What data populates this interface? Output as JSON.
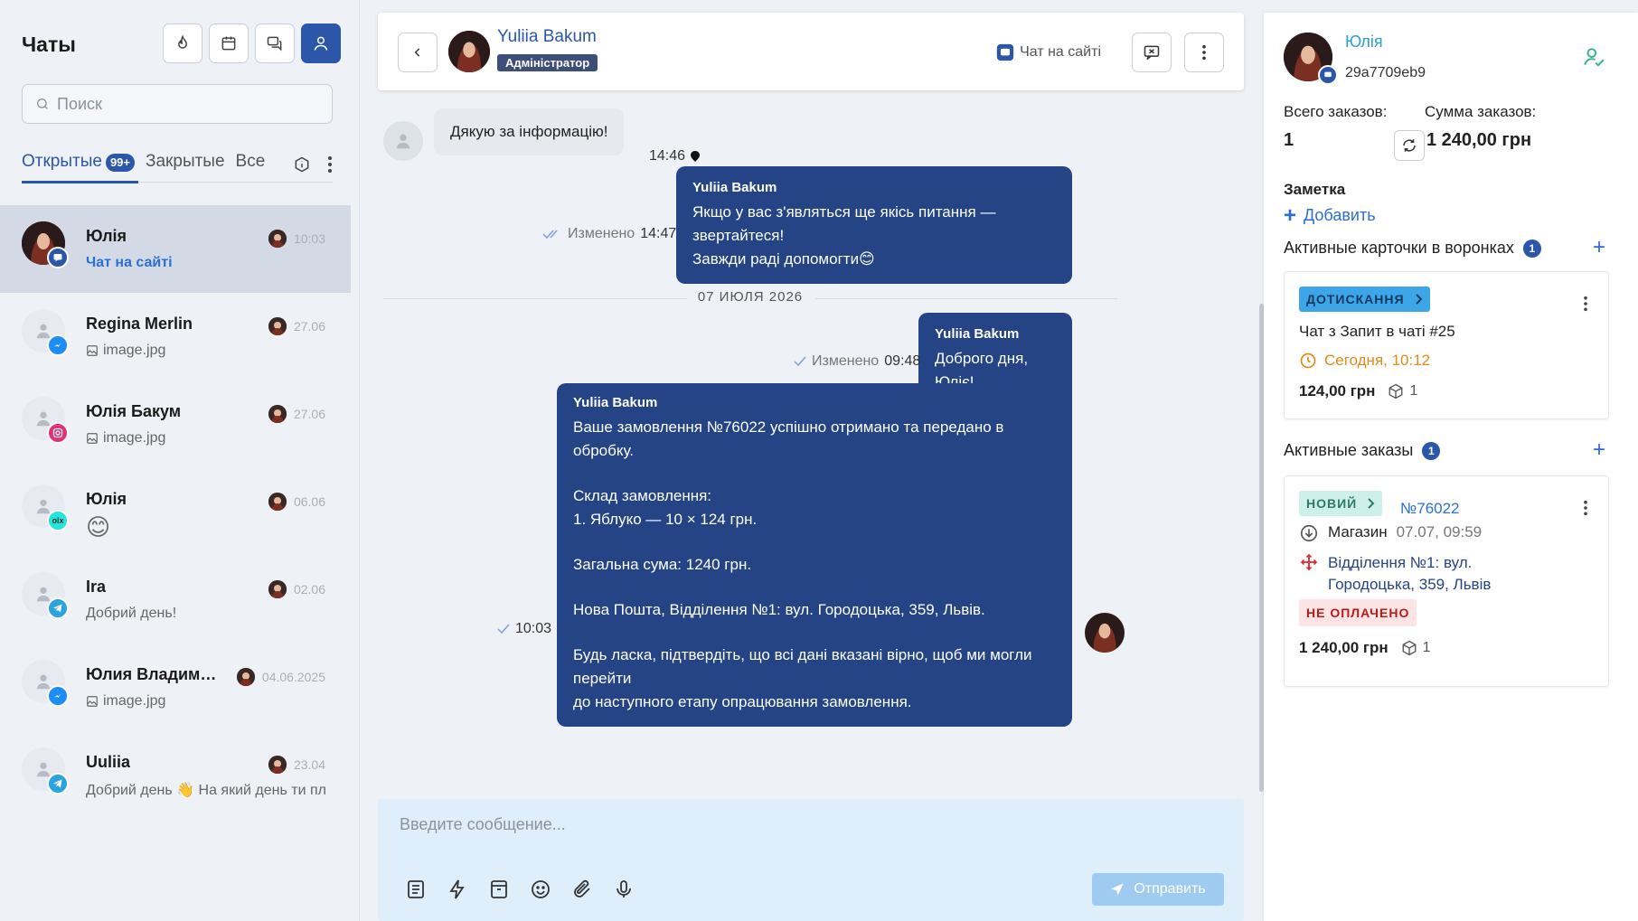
{
  "sidebar": {
    "title": "Чаты",
    "search_placeholder": "Поиск",
    "tabs": [
      {
        "label": "Открытые",
        "badge": "99+"
      },
      {
        "label": "Закрытые"
      },
      {
        "label": "Все"
      }
    ],
    "chats": [
      {
        "name": "Юлія",
        "preview": "Чат на сайті",
        "time": "10:03",
        "channel": "site"
      },
      {
        "name": "Regina Merlin",
        "preview": "image.jpg",
        "time": "27.06",
        "channel": "messenger"
      },
      {
        "name": "Юлія Бакум",
        "preview": "image.jpg",
        "time": "27.06",
        "channel": "instagram"
      },
      {
        "name": "Юлія",
        "preview": "😊",
        "time": "06.06",
        "channel": "olx"
      },
      {
        "name": "Ira",
        "preview": "Добрий день!",
        "time": "02.06",
        "channel": "telegram"
      },
      {
        "name": "Юлия Владимировна",
        "preview": "image.jpg",
        "time": "04.06.2025",
        "channel": "messenger"
      },
      {
        "name": "Uuliia",
        "preview": "Добрий день 👋 На який день ти плануєш",
        "time": "23.04",
        "channel": "telegram"
      }
    ]
  },
  "chat": {
    "header": {
      "name": "Yuliia Bakum",
      "role": "Адміністратор",
      "channel_label": "Чат на сайті"
    },
    "messages": {
      "m1": {
        "text": "Дякую за інформацію!",
        "time": "14:46"
      },
      "m2": {
        "sender": "Yuliia Bakum",
        "line1": "Якщо у вас з'являться ще якісь питання — звертайтеся!",
        "line2": "Завжди раді допомогти😊",
        "edited": "Изменено",
        "time": "14:47"
      },
      "date_separator": "07 ИЮЛЯ 2026",
      "m3": {
        "sender": "Yuliia Bakum",
        "text": "Доброго дня, Юліє!",
        "edited": "Изменено",
        "time": "09:48"
      },
      "m4": {
        "sender": "Yuliia Bakum",
        "lines": [
          "Ваше замовлення №76022 успішно отримано та передано в обробку.",
          "",
          "Склад замовлення:",
          "1. Яблуко — 10 × 124 грн.",
          "",
          "Загальна сума: 1240 грн.",
          "",
          "Нова Пошта, Відділення №1: вул. Городоцька, 359, Львів.",
          "",
          "Будь ласка, підтвердіть, що всі дані вказані вірно, щоб ми могли перейти",
          "до наступного етапу опрацювання замовлення."
        ],
        "time": "10:03"
      }
    },
    "composer": {
      "placeholder": "Введите сообщение...",
      "send_label": "Отправить"
    }
  },
  "client": {
    "name": "Юлія",
    "id": "29a7709eb9",
    "orders_total_label": "Всего заказов:",
    "orders_total": "1",
    "orders_sum_label": "Сумма заказов:",
    "orders_sum": "1 240,00 грн",
    "note_label": "Заметка",
    "add_label": "Добавить",
    "funnels": {
      "title": "Активные карточки в воронках",
      "count": "1",
      "card": {
        "stage": "ДОТИСКАННЯ",
        "title": "Чат з Запит в чаті #25",
        "time": "Сегодня, 10:12",
        "sum": "124,00 грн",
        "qty": "1"
      }
    },
    "orders": {
      "title": "Активные заказы",
      "count": "1",
      "card": {
        "status": "НОВИЙ",
        "number": "№76022",
        "store": "Магазин",
        "store_time": "07.07, 09:59",
        "address_line1": "Відділення №1: вул.",
        "address_line2": "Городоцька, 359, Львів",
        "payment": "НЕ ОПЛАЧЕНО",
        "sum": "1 240,00 грн",
        "qty": "1"
      }
    }
  },
  "colors": {
    "accent": "#2b56a9",
    "bubble_out": "#244485",
    "bubble_in": "#e6e9ee",
    "stage_blue": "#3da6e8",
    "status_new": "#cdf1ea",
    "unpaid_bg": "#fde4e4",
    "warning": "#e48a19"
  }
}
